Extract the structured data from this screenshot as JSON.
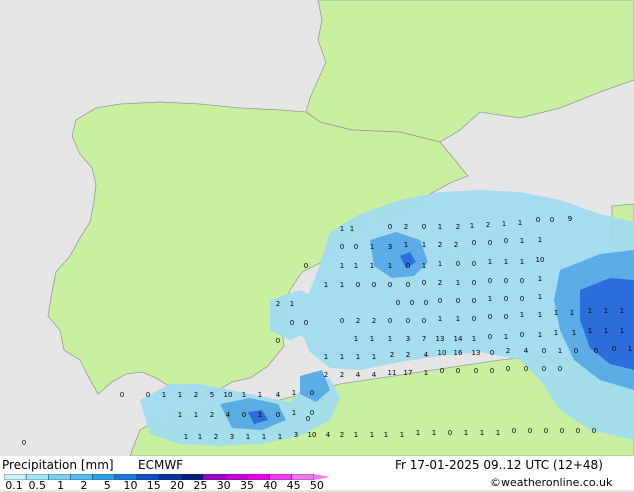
{
  "title": "Precipitation [mm]",
  "model": "ECMWF",
  "valid_time": "Fr 17-01-2025 09..12 UTC (12+48)",
  "credit": "©weatheronline.co.uk",
  "colors": {
    "sea": "#e6e6e6",
    "land": "#c8f0a0",
    "coast": "#999999",
    "precip_light": "#a0dcf0",
    "precip_medium": "#50a8e8",
    "precip_heavy": "#1e64dc"
  },
  "legend": {
    "ticks": [
      "0.1",
      "0.5",
      "1",
      "2",
      "5",
      "10",
      "15",
      "20",
      "25",
      "30",
      "35",
      "40",
      "45",
      "50"
    ],
    "colors": [
      "#c8f0ff",
      "#a0e6fa",
      "#78d2f5",
      "#50bef0",
      "#28a0e6",
      "#1478dc",
      "#0a50c8",
      "#0a32a0",
      "#001e78",
      "#a000c8",
      "#c800dc",
      "#e600e6",
      "#f03cf0",
      "#f078f0"
    ]
  },
  "values": [
    "1",
    "1",
    "0",
    "2",
    "0",
    "1",
    "2",
    "1",
    "2",
    "1",
    "1",
    "0",
    "0",
    "9",
    "0",
    "0",
    "1",
    "3",
    "1",
    "1",
    "2",
    "2",
    "0",
    "0",
    "0",
    "1",
    "1",
    "1",
    "1",
    "1",
    "1",
    "0",
    "1",
    "1",
    "0",
    "0",
    "1",
    "1",
    "1",
    "10",
    "1",
    "1",
    "0",
    "0",
    "0",
    "0",
    "0",
    "2",
    "1",
    "0",
    "0",
    "0",
    "0",
    "1",
    "2",
    "1",
    "0",
    "0",
    "0",
    "0",
    "0",
    "0",
    "1",
    "0",
    "0",
    "1",
    "0",
    "0",
    "0",
    "2",
    "2",
    "0",
    "0",
    "0",
    "1",
    "1",
    "0",
    "0",
    "0",
    "1",
    "1",
    "1",
    "1",
    "1",
    "1",
    "1",
    "1",
    "1",
    "1",
    "3",
    "7",
    "13",
    "14",
    "1",
    "0",
    "1",
    "0",
    "1",
    "1",
    "1",
    "1",
    "1",
    "1",
    "1",
    "1",
    "1",
    "1",
    "2",
    "2",
    "4",
    "10",
    "16",
    "13",
    "0",
    "2",
    "4",
    "0",
    "1",
    "0",
    "0",
    "0",
    "1",
    "2",
    "2",
    "4",
    "4",
    "11",
    "17",
    "1",
    "0",
    "0",
    "0",
    "0",
    "0",
    "0",
    "0",
    "0",
    "0",
    "1",
    "1",
    "2",
    "5",
    "10",
    "1",
    "1",
    "4",
    "1",
    "0",
    "1",
    "1",
    "2",
    "4",
    "0",
    "1",
    "0",
    "1",
    "0",
    "1",
    "1",
    "2",
    "3",
    "1",
    "1",
    "1",
    "3",
    "10",
    "4",
    "2",
    "1",
    "1",
    "1",
    "1",
    "1",
    "1",
    "0",
    "1",
    "1",
    "1",
    "0",
    "0",
    "0",
    "0",
    "0",
    "0"
  ],
  "zero_marker": "0"
}
